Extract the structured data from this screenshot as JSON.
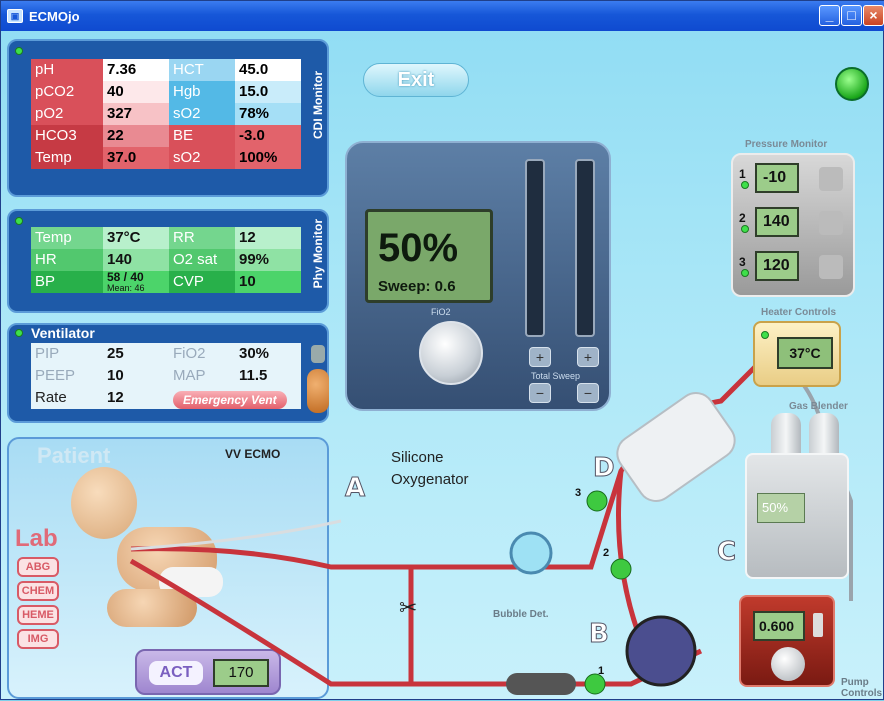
{
  "window": {
    "title": "ECMOjo"
  },
  "cdi": {
    "label": "CDI Monitor",
    "rows": [
      {
        "l1": "pH",
        "v1": "7.36",
        "l2": "HCT",
        "v2": "45.0"
      },
      {
        "l1": "pCO2",
        "v1": "40",
        "l2": "Hgb",
        "v2": "15.0"
      },
      {
        "l1": "pO2",
        "v1": "327",
        "l2": "sO2",
        "v2": "78%"
      },
      {
        "l1": "HCO3",
        "v1": "22",
        "l2": "BE",
        "v2": "-3.0"
      },
      {
        "l1": "Temp",
        "v1": "37.0",
        "l2": "sO2",
        "v2": "100%"
      }
    ]
  },
  "phy": {
    "label": "Phy Monitor",
    "rows": [
      {
        "l1": "Temp",
        "v1": "37°C",
        "l2": "RR",
        "v2": "12"
      },
      {
        "l1": "HR",
        "v1": "140",
        "l2": "O2 sat",
        "v2": "99%"
      },
      {
        "l1": "BP",
        "v1": "58 / 40",
        "v1b": "Mean: 46",
        "l2": "CVP",
        "v2": "10"
      }
    ]
  },
  "vent": {
    "label": "Ventilator",
    "rows": [
      {
        "l1": "PIP",
        "v1": "25",
        "l2": "FiO2",
        "v2": "30%"
      },
      {
        "l1": "PEEP",
        "v1": "10",
        "l2": "MAP",
        "v2": "11.5"
      },
      {
        "l1": "Rate",
        "v1": "12"
      }
    ],
    "emergency": "Emergency Vent"
  },
  "exit_label": "Exit",
  "blender": {
    "fio2": "50%",
    "sweep": "Sweep: 0.6",
    "knob_label": "FiO2",
    "total_sweep": "Total Sweep",
    "plus": "+",
    "minus": "−"
  },
  "pressure": {
    "title": "Pressure Monitor",
    "items": [
      {
        "idx": "1",
        "value": "-10"
      },
      {
        "idx": "2",
        "value": "140"
      },
      {
        "idx": "3",
        "value": "120"
      }
    ]
  },
  "heater": {
    "title": "Heater Controls",
    "value": "37°C"
  },
  "gas": {
    "title": "Gas Blender",
    "value": "50%"
  },
  "pump": {
    "title": "Pump Controls",
    "value": "0.600"
  },
  "oxygenator": {
    "line1": "Silicone",
    "line2": "Oxygenator"
  },
  "patient": {
    "title": "Patient",
    "mode": "VV ECMO"
  },
  "lab": {
    "title": "Lab",
    "buttons": [
      "ABG",
      "CHEM",
      "HEME",
      "IMG"
    ]
  },
  "act": {
    "label": "ACT",
    "value": "170"
  },
  "ports": {
    "A": "A",
    "B": "B",
    "C": "C",
    "D": "D",
    "n1": "1",
    "n2": "2",
    "n3": "3"
  },
  "bubble_label": "Bubble Det."
}
